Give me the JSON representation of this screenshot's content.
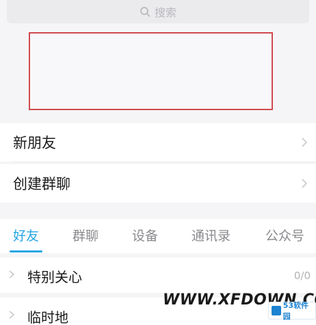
{
  "search": {
    "placeholder": "搜索",
    "icon": "search-icon"
  },
  "menu": {
    "new_friends": "新朋友",
    "create_group_chat": "创建群聊"
  },
  "tabs": [
    {
      "label": "好友",
      "active": true
    },
    {
      "label": "群聊",
      "active": false
    },
    {
      "label": "设备",
      "active": false
    },
    {
      "label": "通讯录",
      "active": false
    },
    {
      "label": "公众号",
      "active": false
    }
  ],
  "groups": [
    {
      "label": "特别关心",
      "count": "0/0"
    },
    {
      "label": "临时地",
      "count": ""
    }
  ],
  "watermark": {
    "text": "WWW.XFDOWN.COM",
    "badge": "53软件园"
  },
  "colors": {
    "accent": "#26a6e5",
    "highlight": "#d0494f"
  }
}
